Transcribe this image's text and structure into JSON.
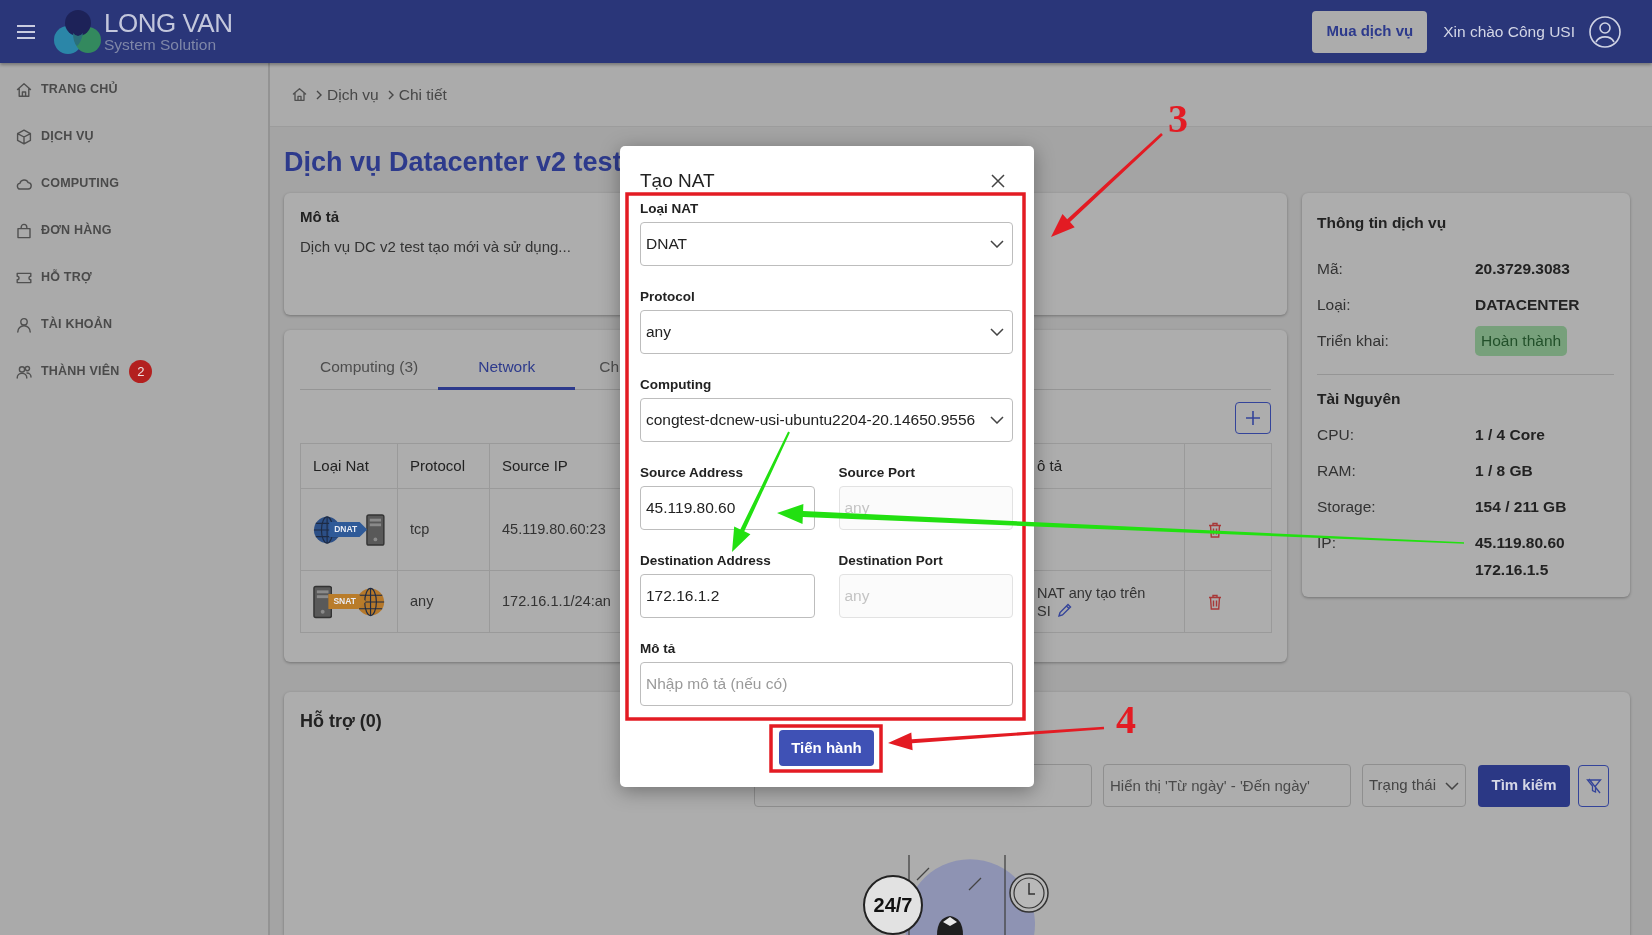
{
  "header": {
    "logo_title": "LONG VAN",
    "logo_subtitle": "System Solution",
    "buy_button": "Mua dịch vụ",
    "greeting": "Xin chào Công USI"
  },
  "sidebar": {
    "items": [
      {
        "label": "TRANG CHỦ",
        "selected": false
      },
      {
        "label": "DỊCH VỤ",
        "selected": false
      },
      {
        "label": "COMPUTING",
        "selected": false
      },
      {
        "label": "ĐƠN HÀNG",
        "selected": false
      },
      {
        "label": "HỖ TRỢ",
        "selected": false
      },
      {
        "label": "TÀI KHOẢN",
        "selected": false
      },
      {
        "label": "THÀNH VIÊN",
        "selected": false,
        "badge": "2"
      }
    ]
  },
  "breadcrumb": {
    "items": [
      "Dịch vụ",
      "Chi tiết"
    ]
  },
  "page_title": "Dịch vụ Datacenter v2 test",
  "description_card": {
    "title": "Mô tả",
    "text": "Dịch vụ DC v2 test tạo mới và sử dụng..."
  },
  "tabs": [
    {
      "label": "Computing (3)",
      "selected": false
    },
    {
      "label": "Network",
      "selected": true
    },
    {
      "label": "Ch",
      "selected": false
    }
  ],
  "nat_table": {
    "columns": [
      "Loại Nat",
      "Protocol",
      "Source IP",
      "ô tả"
    ],
    "rows": [
      {
        "kind": "dnat",
        "nat_label": "DNAT",
        "protocol": "tcp",
        "source_ip": "45.119.80.60:23"
      },
      {
        "kind": "snat",
        "nat_label": "SNAT",
        "protocol": "any",
        "source_ip": "172.16.1.1/24:an",
        "description_lines": [
          "NAT any tạo trên",
          "SI"
        ]
      }
    ]
  },
  "service_info": {
    "title": "Thông tin dịch vụ",
    "rows": [
      {
        "label": "Mã:",
        "value": "20.3729.3083",
        "kind": "text"
      },
      {
        "label": "Loại:",
        "value": "DATACENTER",
        "kind": "text"
      },
      {
        "label": "Triển khai:",
        "value": "Hoàn thành",
        "kind": "badge"
      }
    ]
  },
  "resources": {
    "title": "Tài Nguyên",
    "rows": [
      {
        "label": "CPU:",
        "values": [
          "1 / 4 Core"
        ]
      },
      {
        "label": "RAM:",
        "values": [
          "1 / 8 GB"
        ]
      },
      {
        "label": "Storage:",
        "values": [
          "154 / 211 GB"
        ]
      },
      {
        "label": "IP:",
        "values": [
          "45.119.80.60",
          "172.16.1.5"
        ]
      }
    ]
  },
  "support": {
    "title": "Hỗ trợ (0)",
    "date_range_placeholder": "Hiển thị 'Từ ngày' - 'Đến ngày'",
    "status_select": "Trạng thái",
    "search_button": "Tìm kiếm",
    "emblem": "24/7"
  },
  "modal": {
    "title": "Tạo NAT",
    "rows": [
      [
        {
          "label": "Loại NAT",
          "kind": "select",
          "value": "DNAT",
          "disabled": false
        }
      ],
      [
        {
          "label": "Protocol",
          "kind": "select",
          "value": "any",
          "disabled": false
        }
      ],
      [
        {
          "label": "Computing",
          "kind": "select",
          "value": "congtest-dcnew-usi-ubuntu2204-20.14650.9556",
          "disabled": false
        }
      ],
      [
        {
          "label": "Source Address",
          "kind": "input",
          "value": "45.119.80.60",
          "disabled": false
        },
        {
          "label": "Source Port",
          "kind": "input",
          "placeholder": "any",
          "disabled": true
        }
      ],
      [
        {
          "label": "Destination Address",
          "kind": "input",
          "value": "172.16.1.2",
          "disabled": false
        },
        {
          "label": "Destination Port",
          "kind": "input",
          "placeholder": "any",
          "disabled": true
        }
      ],
      [
        {
          "label": "Mô tả",
          "kind": "input",
          "placeholder": "Nhập mô tả (nếu có)",
          "disabled": false
        }
      ]
    ],
    "submit": "Tiến hành"
  },
  "callouts": [
    {
      "number": "3"
    },
    {
      "number": "4"
    }
  ]
}
